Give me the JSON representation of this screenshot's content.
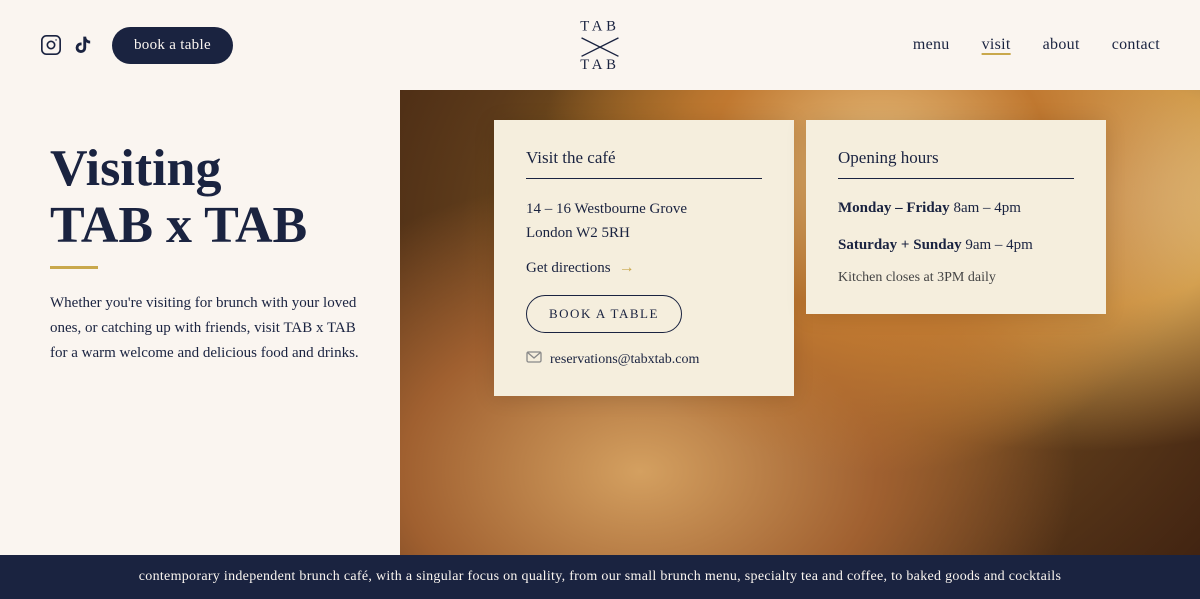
{
  "header": {
    "book_btn": "book a table",
    "nav": {
      "menu": "menu",
      "visit": "visit",
      "about": "about",
      "contact": "contact"
    },
    "logo_top": "TAB",
    "logo_bottom": "TAB"
  },
  "hero": {
    "heading_line1": "Visiting",
    "heading_line2": "TAB x TAB",
    "description": "Whether you're visiting for brunch with your loved ones, or catching up with friends, visit TAB x TAB for a warm welcome and delicious food and drinks."
  },
  "visit_card": {
    "title": "Visit the café",
    "address_line1": "14 – 16 Westbourne Grove",
    "address_line2": "London W2 5RH",
    "directions": "Get directions",
    "book_btn": "BOOK A TABLE",
    "email_label": "reservations@tabxtab.com"
  },
  "hours_card": {
    "title": "Opening hours",
    "row1_label": "Monday – Friday",
    "row1_hours": " 8am – 4pm",
    "row2_label": "Saturday + Sunday",
    "row2_hours": " 9am – 4pm",
    "kitchen_note": "Kitchen closes at 3PM daily"
  },
  "footer": {
    "text": "contemporary independent brunch café, with a singular focus on quality, from our small brunch menu, specialty tea and coffee, to baked goods and cocktails"
  },
  "colors": {
    "dark_navy": "#1a2340",
    "cream": "#faf5f0",
    "card_bg": "#f5eedd",
    "gold": "#c9a84c"
  }
}
